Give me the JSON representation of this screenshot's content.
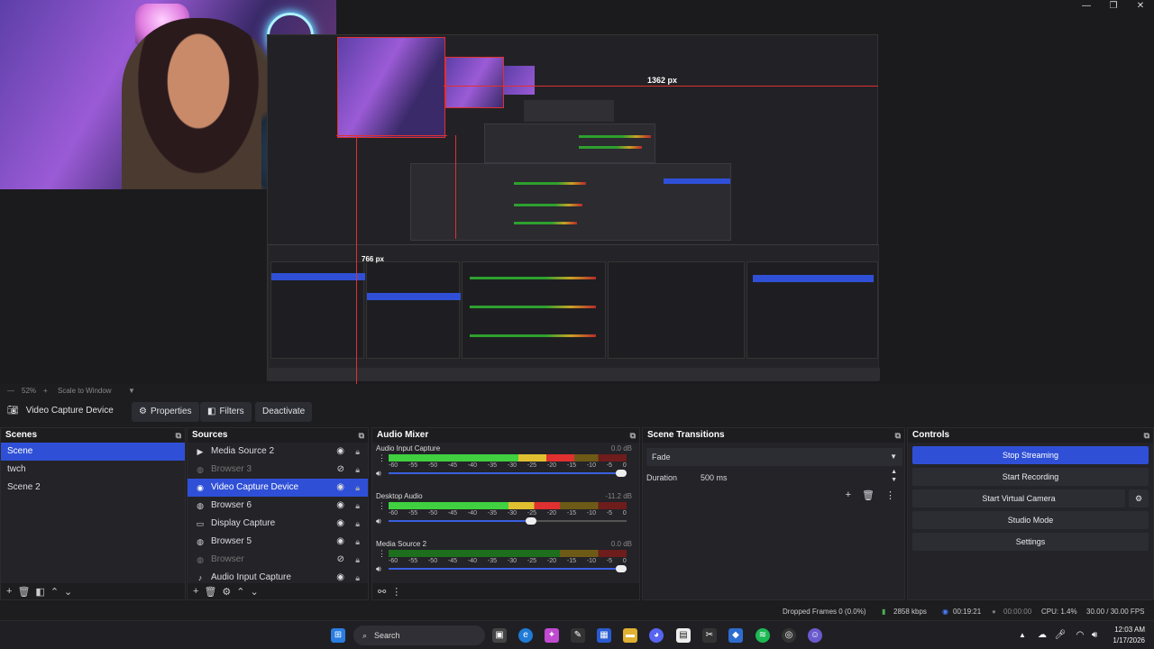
{
  "window": {
    "controls": [
      "—",
      "❐",
      "✕"
    ]
  },
  "preview": {
    "measure_label_h": "1362 px",
    "measure_label_v": "766 px"
  },
  "zoom": {
    "percent": "52%",
    "mode": "Scale to Window"
  },
  "source_toolbar": {
    "selected_source": "Video Capture Device",
    "properties_label": "Properties",
    "filters_label": "Filters",
    "deactivate_label": "Deactivate"
  },
  "scenes": {
    "title": "Scenes",
    "items": [
      {
        "label": "Scene",
        "active": true
      },
      {
        "label": "twch",
        "active": false
      },
      {
        "label": "Scene 2",
        "active": false
      }
    ]
  },
  "sources": {
    "title": "Sources",
    "items": [
      {
        "label": "Media Source 2",
        "icon": "play-icon",
        "visible": true,
        "active": false
      },
      {
        "label": "Browser 3",
        "icon": "globe-icon",
        "visible": false,
        "active": false
      },
      {
        "label": "Video Capture Device",
        "icon": "camera-icon",
        "visible": true,
        "active": true
      },
      {
        "label": "Browser 6",
        "icon": "globe-icon",
        "visible": true,
        "active": false
      },
      {
        "label": "Display Capture",
        "icon": "monitor-icon",
        "visible": true,
        "active": false
      },
      {
        "label": "Browser 5",
        "icon": "globe-icon",
        "visible": true,
        "active": false
      },
      {
        "label": "Browser",
        "icon": "globe-icon",
        "visible": false,
        "active": false
      },
      {
        "label": "Audio Input Capture",
        "icon": "mic-icon",
        "visible": true,
        "active": false
      }
    ]
  },
  "audio_mixer": {
    "title": "Audio Mixer",
    "ticks": [
      "-60",
      "-55",
      "-50",
      "-45",
      "-40",
      "-35",
      "-30",
      "-25",
      "-20",
      "-15",
      "-10",
      "-5",
      "0"
    ],
    "channels": [
      {
        "name": "Audio Input Capture",
        "db": "0.0 dB",
        "level": 0.78,
        "volume": 1.0
      },
      {
        "name": "Desktop Audio",
        "db": "-11.2 dB",
        "level": 0.72,
        "volume": 0.62
      },
      {
        "name": "Media Source 2",
        "db": "0.0 dB",
        "level": 0.0,
        "volume": 1.0
      }
    ]
  },
  "scene_transitions": {
    "title": "Scene Transitions",
    "transition": "Fade",
    "duration_label": "Duration",
    "duration_value": "500 ms"
  },
  "controls": {
    "title": "Controls",
    "stop_streaming": "Stop Streaming",
    "start_recording": "Start Recording",
    "start_virtual_camera": "Start Virtual Camera",
    "studio_mode": "Studio Mode",
    "settings": "Settings"
  },
  "status": {
    "dropped_frames": "Dropped Frames 0 (0.0%)",
    "bitrate": "2858 kbps",
    "stream_time": "00:19:21",
    "record_time": "00:00:00",
    "cpu": "CPU: 1.4%",
    "fps": "30.00 / 30.00 FPS"
  },
  "taskbar": {
    "search_label": "Search",
    "time": "12:03 AM",
    "date": "1/17/2026"
  },
  "colors": {
    "accent": "#2f50d6",
    "panel": "#232328",
    "background": "#1d1d20",
    "red_guide": "#e03030"
  }
}
